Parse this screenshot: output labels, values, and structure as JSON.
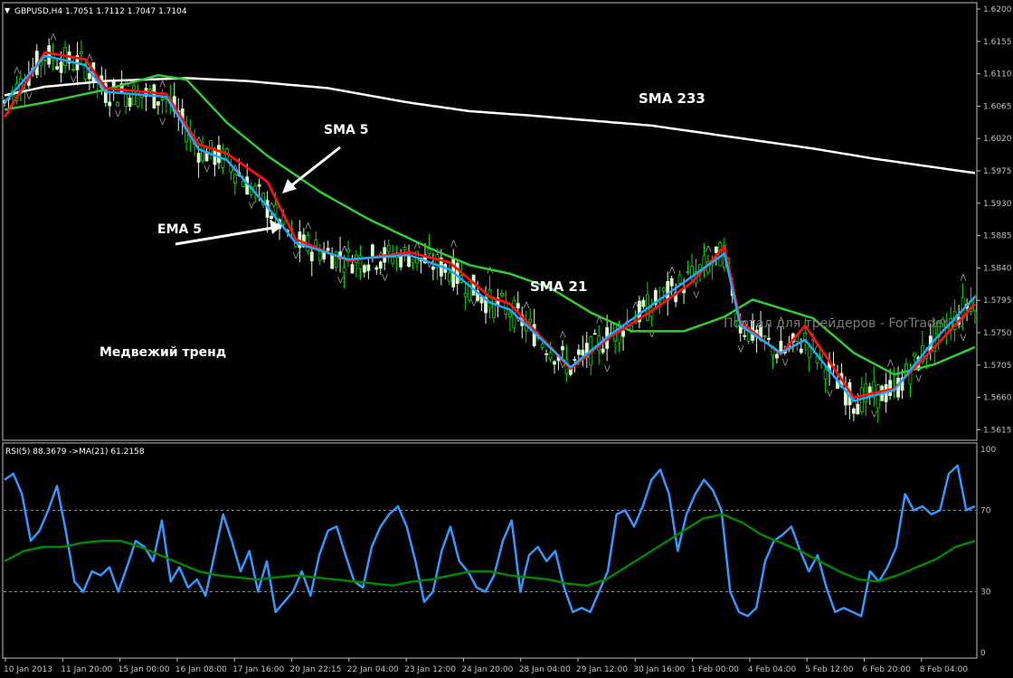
{
  "window": {
    "symbol_header": "GBPUSD,H4  1.7051 1.7112 1.7047 1.7104",
    "watermark": "Портал для трейдеров - ForTrader.ru"
  },
  "colors": {
    "background": "#000000",
    "axis": "#c0c0c0",
    "bull_candle": "#dcffd0",
    "bear_candle": "#00e000",
    "sma5": "#ff1010",
    "ema5": "#20a8ff",
    "sma21": "#33cc33",
    "sma233": "#ffffff",
    "rsi": "#3399ff",
    "rsi_ma": "#008800",
    "fractal": "#b0b0b0"
  },
  "annotations": {
    "sma233": "SMA 233",
    "sma5": "SMA 5",
    "ema5": "EMA 5",
    "sma21": "SMA 21",
    "trend": "Медвежий тренд"
  },
  "chart_data": [
    {
      "type": "candlestick",
      "title": "GBPUSD,H4  1.7051 1.7112 1.7047 1.7104",
      "ylim": [
        1.6195,
        1.5608
      ],
      "y_ticks": [
        "1.6200",
        "1.6155",
        "1.6110",
        "1.6065",
        "1.6020",
        "1.5975",
        "1.5930",
        "1.5885",
        "1.5840",
        "1.5795",
        "1.5750",
        "1.5705",
        "1.5660",
        "1.5615"
      ],
      "x_labels": [
        "10 Jan 2013",
        "11 Jan 20:00",
        "15 Jan 00:00",
        "16 Jan 08:00",
        "17 Jan 16:00",
        "20 Jan 22:15",
        "22 Jan 04:00",
        "23 Jan 12:00",
        "24 Jan 20:00",
        "28 Jan 04:00",
        "29 Jan 12:00",
        "30 Jan 16:00",
        "1 Feb 00:00",
        "4 Feb 04:00",
        "5 Feb 12:00",
        "6 Feb 20:00",
        "8 Feb 04:00"
      ],
      "series": [
        {
          "name": "SMA 233",
          "close_path": [
            1.608,
            1.6092,
            1.61,
            1.6104,
            1.61,
            1.609,
            1.607,
            1.6058,
            1.6052,
            1.6045,
            1.6038,
            1.6022,
            1.6006,
            1.5992,
            1.5972
          ],
          "x_index": [
            0,
            10,
            25,
            45,
            60,
            80,
            100,
            115,
            130,
            145,
            160,
            180,
            200,
            215,
            240
          ]
        },
        {
          "name": "SMA 21",
          "close_path": [
            1.606,
            1.607,
            1.6088,
            1.6108,
            1.6102,
            1.6042,
            1.5996,
            1.5946,
            1.5908,
            1.5868,
            1.5844,
            1.5832,
            1.5812,
            1.5778,
            1.5752,
            1.5752,
            1.5772,
            1.5796,
            1.577,
            1.5722,
            1.5692,
            1.5706,
            1.573
          ],
          "x_index": [
            0,
            10,
            25,
            38,
            45,
            55,
            65,
            78,
            90,
            105,
            115,
            125,
            135,
            145,
            155,
            168,
            178,
            185,
            200,
            210,
            220,
            230,
            240
          ]
        },
        {
          "name": "SMA 5",
          "close_path": [
            1.605,
            1.614,
            1.613,
            1.609,
            1.6082,
            1.6012,
            1.5999,
            1.596,
            1.588,
            1.585,
            1.5862,
            1.5848,
            1.58,
            1.579,
            1.57,
            1.5745,
            1.578,
            1.582,
            1.587,
            1.5765,
            1.572,
            1.576,
            1.566,
            1.5672,
            1.573,
            1.579
          ],
          "x_index": [
            0,
            10,
            20,
            25,
            40,
            48,
            55,
            65,
            72,
            85,
            100,
            110,
            120,
            125,
            140,
            150,
            160,
            170,
            178,
            182,
            192,
            198,
            210,
            220,
            230,
            240
          ]
        },
        {
          "name": "EMA 5",
          "close_path": [
            1.607,
            1.6135,
            1.6122,
            1.6085,
            1.6078,
            1.6005,
            1.599,
            1.5925,
            1.5875,
            1.5852,
            1.5858,
            1.5838,
            1.5792,
            1.5782,
            1.5702,
            1.5748,
            1.5788,
            1.5828,
            1.586,
            1.576,
            1.5722,
            1.574,
            1.5655,
            1.567,
            1.574,
            1.58
          ],
          "x_index": [
            0,
            10,
            20,
            25,
            40,
            48,
            55,
            65,
            72,
            85,
            100,
            110,
            120,
            125,
            140,
            150,
            160,
            170,
            178,
            182,
            192,
            198,
            210,
            220,
            230,
            240
          ]
        }
      ]
    },
    {
      "type": "line",
      "title": "RSI(5) 88.3679  ->MA(21) 61.2158",
      "ylim": [
        0,
        100
      ],
      "y_ticks": [
        "100",
        "70",
        "30",
        "0"
      ],
      "levels": [
        70,
        30
      ],
      "series": [
        {
          "name": "RSI(5)",
          "values": [
            85,
            88,
            78,
            55,
            60,
            70,
            82,
            60,
            35,
            30,
            40,
            38,
            42,
            30,
            42,
            55,
            52,
            45,
            65,
            35,
            42,
            32,
            36,
            28,
            48,
            68,
            55,
            40,
            50,
            30,
            45,
            20,
            25,
            30,
            40,
            28,
            48,
            60,
            62,
            48,
            35,
            32,
            52,
            62,
            68,
            72,
            62,
            45,
            25,
            30,
            50,
            62,
            45,
            40,
            32,
            30,
            38,
            55,
            65,
            30,
            48,
            52,
            45,
            50,
            32,
            20,
            22,
            20,
            30,
            40,
            68,
            70,
            62,
            72,
            85,
            90,
            78,
            50,
            68,
            78,
            85,
            80,
            70,
            30,
            20,
            18,
            22,
            45,
            55,
            58,
            62,
            50,
            40,
            48,
            32,
            20,
            22,
            20,
            18,
            40,
            35,
            42,
            52,
            78,
            70,
            72,
            68,
            70,
            88,
            92,
            70,
            72
          ]
        },
        {
          "name": "MA(21)",
          "values": [
            45,
            50,
            52,
            52,
            54,
            55,
            55,
            52,
            48,
            44,
            40,
            38,
            37,
            36,
            37,
            38,
            37,
            36,
            35,
            34,
            33,
            35,
            36,
            38,
            40,
            40,
            38,
            37,
            36,
            34,
            33,
            36,
            42,
            48,
            54,
            60,
            66,
            68,
            64,
            58,
            54,
            50,
            45,
            40,
            36,
            35,
            38,
            42,
            46,
            52,
            55
          ]
        }
      ]
    }
  ]
}
